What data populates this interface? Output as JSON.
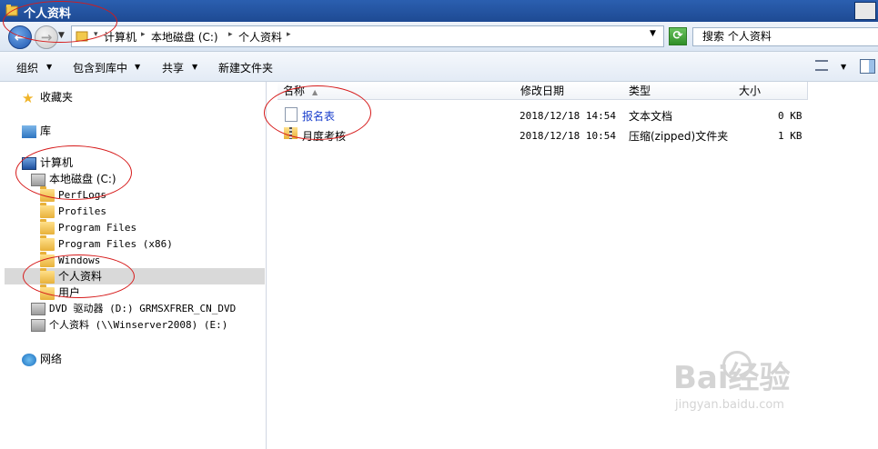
{
  "window": {
    "title": "个人资料"
  },
  "address": {
    "crumbs": [
      "计算机",
      "本地磁盘 (C:)",
      "个人资料"
    ]
  },
  "search": {
    "placeholder": "搜索 个人资料"
  },
  "toolbar": {
    "organize": "组织",
    "include_in_library": "包含到库中",
    "share": "共享",
    "new_folder": "新建文件夹"
  },
  "nav": {
    "favorites": "收藏夹",
    "libraries": "库",
    "computer": "计算机",
    "local_disk": "本地磁盘 (C:)",
    "folders": [
      "PerfLogs",
      "Profiles",
      "Program Files",
      "Program Files (x86)",
      "Windows",
      "个人资料",
      "用户"
    ],
    "dvd_drive": "DVD 驱动器 (D:) GRMSXFRER_CN_DVD",
    "network_share": "个人资料 (\\\\Winserver2008) (E:)",
    "network": "网络"
  },
  "columns": {
    "name": "名称",
    "modified": "修改日期",
    "type": "类型",
    "size": "大小"
  },
  "files": [
    {
      "name": "报名表",
      "modified": "2018/12/18 14:54",
      "type": "文本文档",
      "size": "0 KB",
      "icon": "text-file-icon"
    },
    {
      "name": "月度考核",
      "modified": "2018/12/18 10:54",
      "type": "压缩(zipped)文件夹",
      "size": "1 KB",
      "icon": "zip-folder-icon"
    }
  ],
  "watermark": {
    "logo": "Bai经验",
    "url": "jingyan.baidu.com"
  },
  "colors": {
    "annotation": "#d61a1a",
    "titlebar": "#1e4a93",
    "link": "#1a3fcc"
  }
}
